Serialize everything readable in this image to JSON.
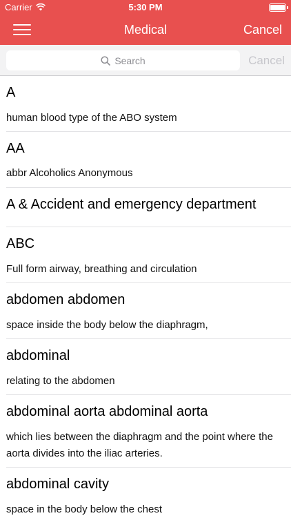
{
  "status_bar": {
    "carrier": "Carrier",
    "time": "5:30 PM",
    "wifi_icon": "wifi-icon",
    "battery_icon": "battery-icon"
  },
  "nav": {
    "menu_icon": "hamburger-menu-icon",
    "title": "Medical",
    "cancel_label": "Cancel"
  },
  "search": {
    "placeholder": "Search",
    "search_icon": "magnifier-icon",
    "cancel_label": "Cancel"
  },
  "entries": [
    {
      "term": "A",
      "definition": "human blood type of the ABO system"
    },
    {
      "term": "AA",
      "definition": "abbr Alcoholics Anonymous"
    },
    {
      "term": "A & Accident and emergency department",
      "definition": ""
    },
    {
      "term": "ABC",
      "definition": "Full form airway, breathing and circulation"
    },
    {
      "term": "abdomen abdomen",
      "definition": "space inside the body below the diaphragm,"
    },
    {
      "term": "abdominal",
      "definition": "relating to the abdomen"
    },
    {
      "term": "abdominal aorta abdominal aorta",
      "definition": "which lies between the diaphragm and the point where the aorta divides into the iliac arteries."
    },
    {
      "term": "abdominal cavity",
      "definition": "space in the body below the chest"
    }
  ],
  "colors": {
    "header_background": "#e8504f",
    "search_bar_background": "#f3f3f4",
    "disabled_cancel": "#c7c7cc"
  }
}
